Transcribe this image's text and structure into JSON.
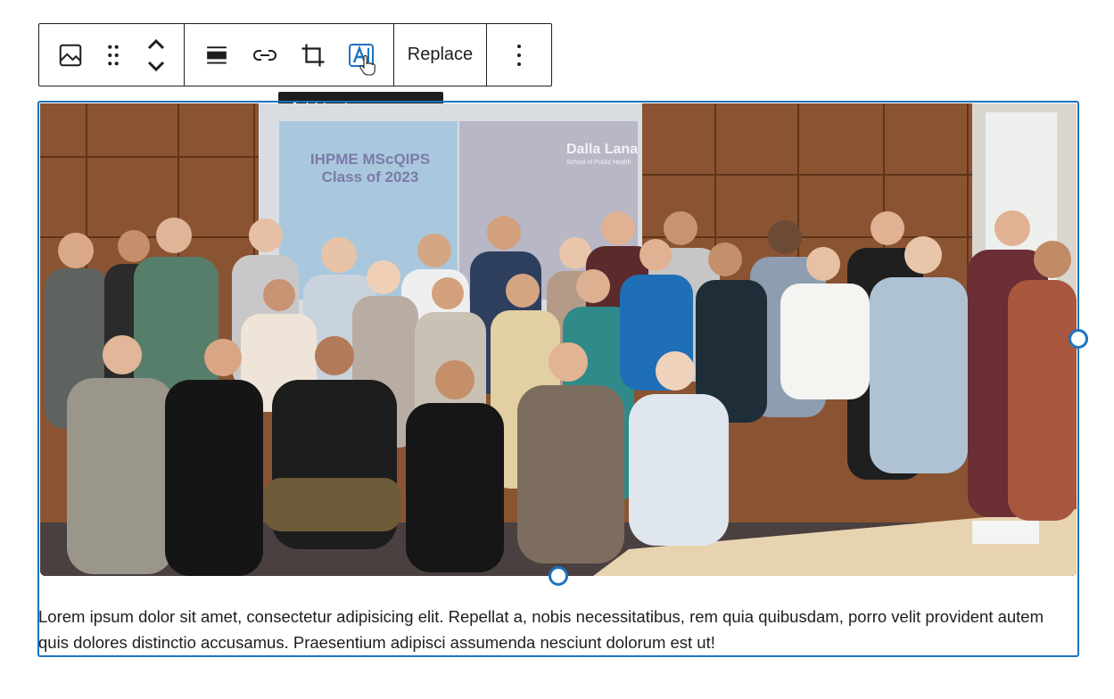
{
  "toolbar": {
    "buttons": [
      {
        "name": "image-block-icon"
      },
      {
        "name": "drag-handle-icon"
      },
      {
        "name": "move-up-down-icon"
      },
      {
        "name": "align-icon"
      },
      {
        "name": "link-icon"
      },
      {
        "name": "crop-icon"
      },
      {
        "name": "add-text-over-image-icon"
      }
    ],
    "replace_label": "Replace",
    "more_options_icon": "vertical-ellipsis-icon",
    "active_color": "#1e73be"
  },
  "tooltip": {
    "text": "Add text over image"
  },
  "image": {
    "slide_title_line1": "IHPME MScQIPS",
    "slide_title_line2": "Class of 2023",
    "slide_logo_line1": "Dalla Lana",
    "slide_logo_line2": "School of Public Health",
    "outline_color": "#1e73be"
  },
  "caption": {
    "text": "Lorem ipsum dolor sit amet, consectetur adipisicing elit. Repellat a, nobis necessitatibus, rem quia quibusdam, porro velit provident autem quis dolores distinctio accusamus. Praesentium adipisci assumenda nesciunt dolorum est ut!"
  }
}
